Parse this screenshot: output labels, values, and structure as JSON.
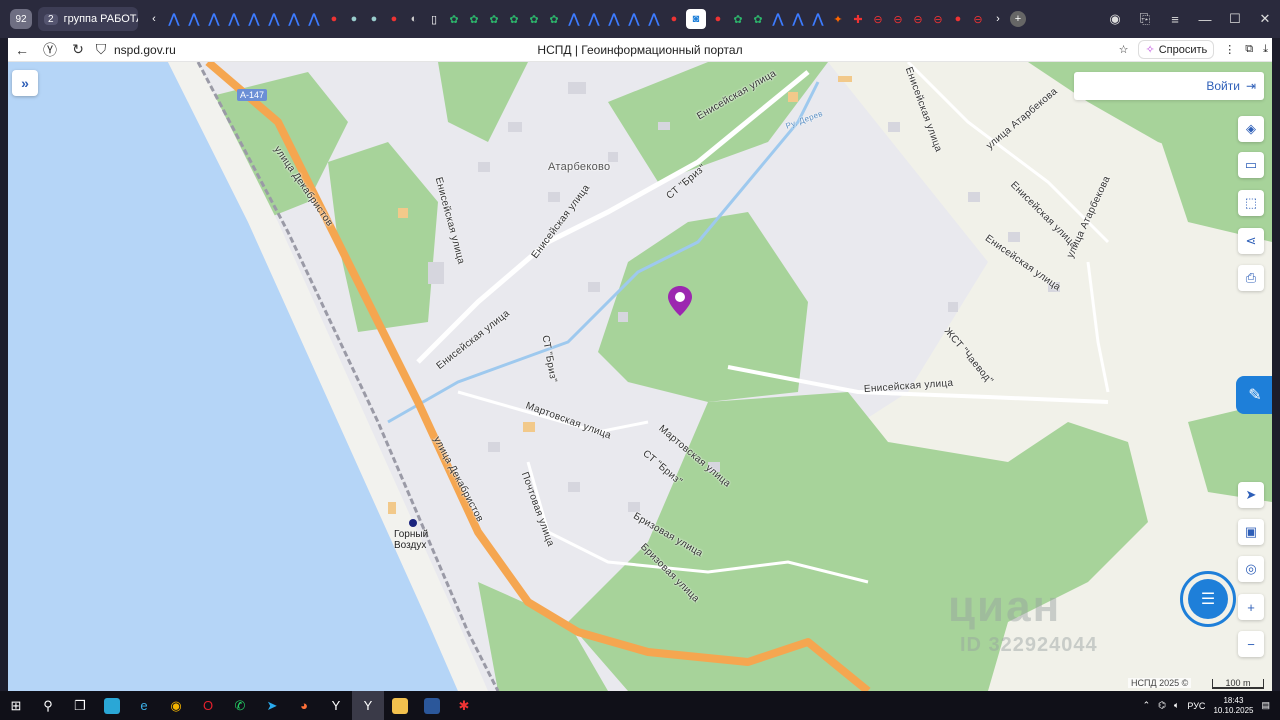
{
  "browser": {
    "tab_count": "92",
    "tab_group_number": "2",
    "tab_group_label": "группа РАБОТА",
    "url": "nspd.gov.ru",
    "page_title": "НСПД | Геоинформационный портал",
    "ask_label": "Спросить"
  },
  "map": {
    "login_label": "Войти",
    "highway_badge": "А-147",
    "station_name_line1": "Горный",
    "station_name_line2": "Воздух",
    "copyright": "НСПД 2025 ©",
    "scale": "100 m",
    "watermark": "циан",
    "watermark_id": "ID 322924044",
    "labels": [
      {
        "text": "улица Декабристов",
        "key": "dekabristov1"
      },
      {
        "text": "улица Декабристов",
        "key": "dekabristov2"
      },
      {
        "text": "Енисейская улица",
        "key": "enis1"
      },
      {
        "text": "Енисейская улица",
        "key": "enis2"
      },
      {
        "text": "Енисейская улица",
        "key": "enis3"
      },
      {
        "text": "Енисейская улица",
        "key": "enis4"
      },
      {
        "text": "Енисейская улица",
        "key": "enis5"
      },
      {
        "text": "Енисейская улица",
        "key": "enis6"
      },
      {
        "text": "Енисейская улица",
        "key": "enis7"
      },
      {
        "text": "Атарбеково",
        "key": "atarbekovo"
      },
      {
        "text": "СТ \"Бриз\"",
        "key": "briz1"
      },
      {
        "text": "СТ \"Бриз\"",
        "key": "briz2"
      },
      {
        "text": "СТ \"Бриз\"",
        "key": "briz3"
      },
      {
        "text": "Ру. Дерев",
        "key": "river"
      },
      {
        "text": "Мартовская улица",
        "key": "mart1"
      },
      {
        "text": "Мартовская улица",
        "key": "mart2"
      },
      {
        "text": "Почтовая улица",
        "key": "pocht"
      },
      {
        "text": "Бризовая улица",
        "key": "briz_st1"
      },
      {
        "text": "Бризовая улица",
        "key": "briz_st2"
      },
      {
        "text": "улица Атарбекова",
        "key": "atar1"
      },
      {
        "text": "улица Атарбекова",
        "key": "atar2"
      },
      {
        "text": "ЖСТ \"Чаевод\"",
        "key": "chaevod"
      },
      {
        "text": "Енисейская улица",
        "key": "enis8"
      }
    ]
  },
  "taskbar": {
    "lang": "РУС",
    "time": "18:43",
    "date": "10.10.2025"
  },
  "colors": {
    "sea": "#b5d5f7",
    "beach": "#f2f2ee",
    "forest": "#a7d39a",
    "urban": "#e8e8ed",
    "highway": "#f5a650",
    "marker": "#9c27b0",
    "accent": "#2e5fb8"
  }
}
